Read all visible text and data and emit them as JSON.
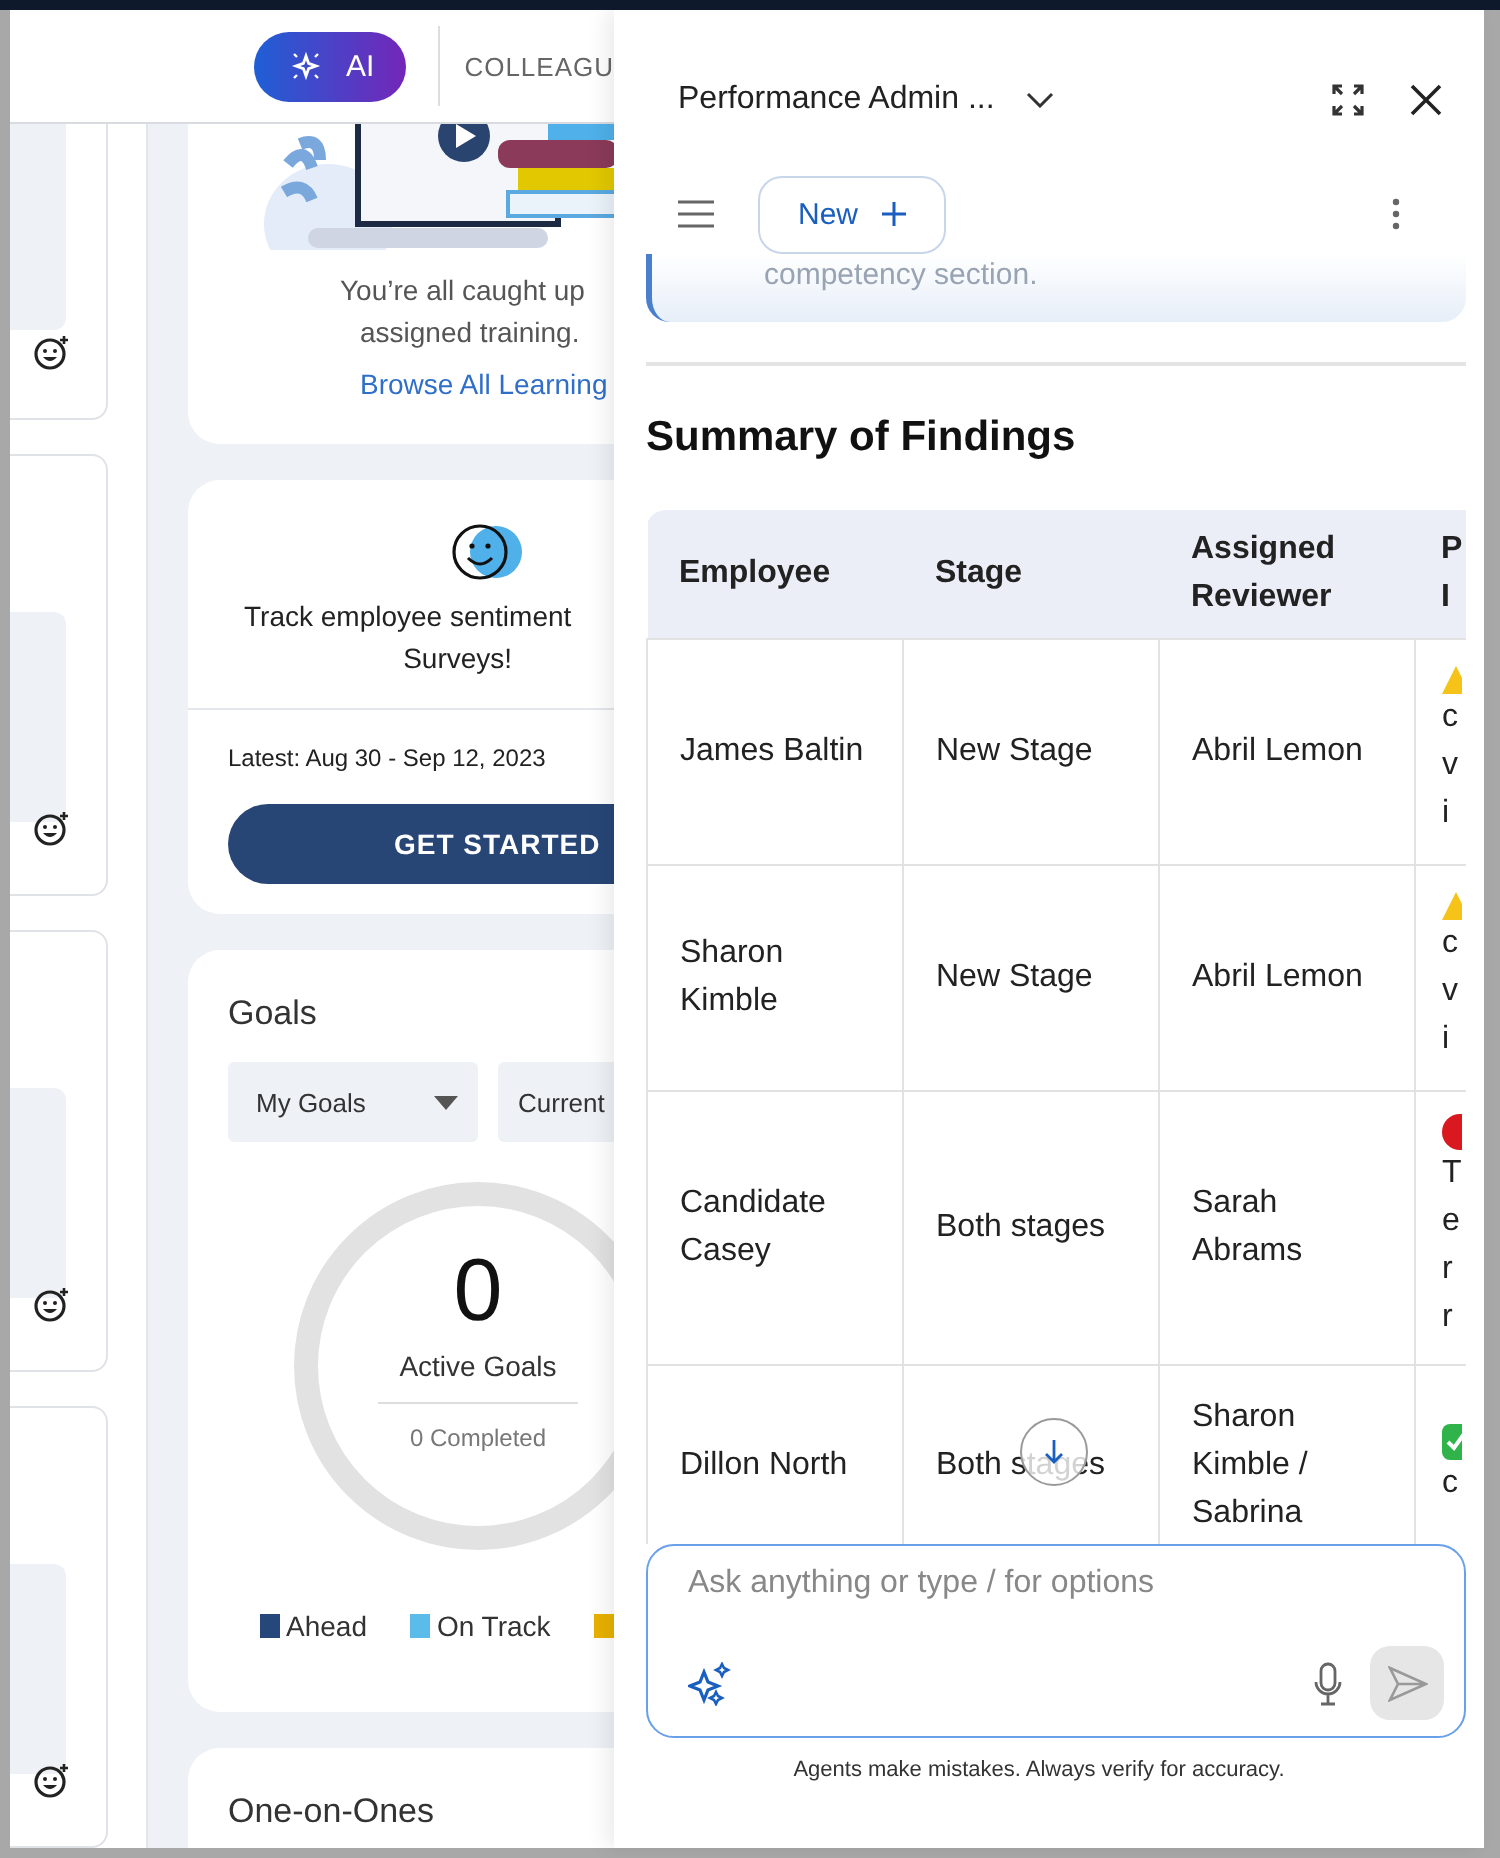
{
  "header": {
    "ai_button": "AI",
    "nav_item": "COLLEAGU"
  },
  "learning_card": {
    "message_lines": [
      "You’re all caught up",
      "assigned training."
    ],
    "link": "Browse All Learning"
  },
  "survey_card": {
    "message_lines": [
      "Track employee sentiment",
      "Surveys!"
    ],
    "latest": "Latest: Aug 30 - Sep 12, 2023",
    "button": "GET STARTED"
  },
  "goals_card": {
    "title": "Goals",
    "filters": [
      "My Goals",
      "Current"
    ],
    "count": "0",
    "count_label": "Active Goals",
    "completed": "0 Completed",
    "legend": [
      {
        "label": "Ahead",
        "color": "#26477a"
      },
      {
        "label": "On Track",
        "color": "#5bbcea"
      },
      {
        "color": "#e8b100"
      }
    ]
  },
  "one_on_ones": {
    "title": "One-on-Ones"
  },
  "panel": {
    "title": "Performance Admin ...",
    "new_button": "New",
    "previous_text": "competency section.",
    "heading": "Summary of Findings",
    "table": {
      "columns": [
        "Employee",
        "Stage",
        "Assigned Reviewer",
        "P I"
      ],
      "rows": [
        {
          "employee": "James Baltin",
          "stage": "New Stage",
          "reviewer": "Abril Lemon",
          "kind": "warning",
          "issue": "c v i"
        },
        {
          "employee": "Sharon Kimble",
          "stage": "New Stage",
          "reviewer": "Abril Lemon",
          "kind": "warning",
          "issue": "c v i"
        },
        {
          "employee": "Candidate Casey",
          "stage": "Both stages",
          "reviewer": "Sarah Abrams",
          "kind": "error",
          "issue": "T e r r"
        },
        {
          "employee": "Dillon North",
          "stage": "Both stages",
          "reviewer": "Sharon Kimble / Sabrina",
          "kind": "ok",
          "issue": "c"
        }
      ]
    },
    "input": {
      "placeholder": "Ask anything or type / for options"
    },
    "disclaimer": "Agents make mistakes. Always verify for accuracy."
  }
}
